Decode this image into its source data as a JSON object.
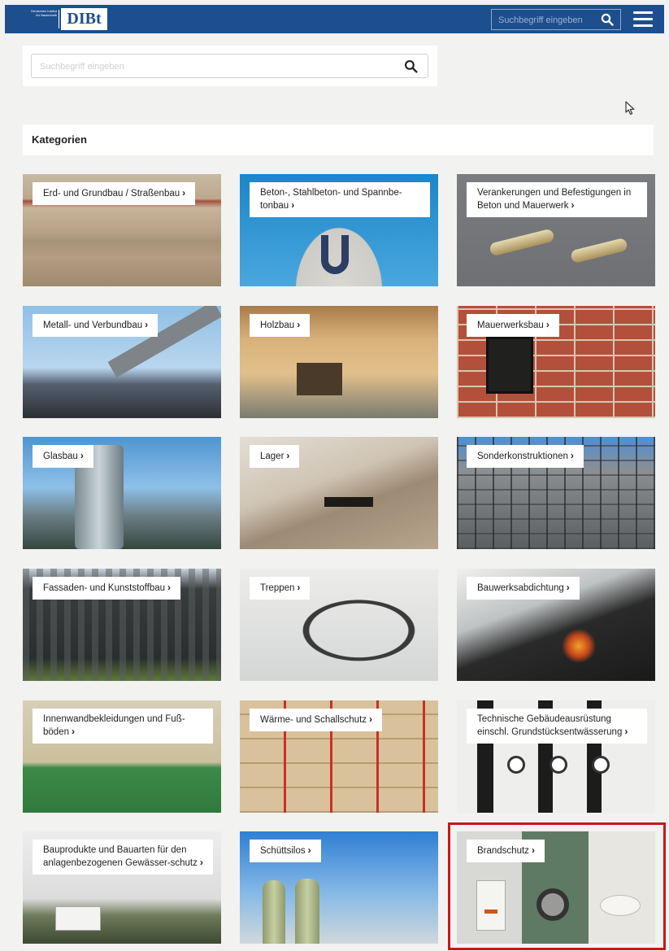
{
  "header": {
    "logo_small": "Deutsches Institut für Bautechnik",
    "logo_main": "DIBt",
    "search_placeholder": "Suchbegriff eingeben",
    "search_icon": "search-icon",
    "menu_icon": "hamburger-menu-icon"
  },
  "search": {
    "placeholder": "Suchbegriff eingeben",
    "icon": "search-icon"
  },
  "section_title": "Kategorien",
  "chevron": "›",
  "tiles": [
    {
      "label": "Erd- und Grundbau / Straßenbau",
      "image": "building-site-photo"
    },
    {
      "label": "Beton-, Stahlbeton- und Spannbe-tonbau",
      "image": "concrete-tower-photo"
    },
    {
      "label": "Verankerungen und Befestigungen in Beton und Mauerwerk",
      "image": "anchor-bolts-photo"
    },
    {
      "label": "Metall- und Verbundbau",
      "image": "steel-structure-photo"
    },
    {
      "label": "Holzbau",
      "image": "timber-house-photo"
    },
    {
      "label": "Mauerwerksbau",
      "image": "brick-wall-lamp-photo"
    },
    {
      "label": "Glasbau",
      "image": "glass-tower-photo"
    },
    {
      "label": "Lager",
      "image": "bridge-bearing-photo"
    },
    {
      "label": "Sonderkonstruktionen",
      "image": "scaffolding-building-photo"
    },
    {
      "label": "Fassaden- und Kunststoffbau",
      "image": "dark-facade-photo"
    },
    {
      "label": "Treppen",
      "image": "spiral-staircase-photo"
    },
    {
      "label": "Bauwerksabdichtung",
      "image": "roof-torch-photo"
    },
    {
      "label": "Innenwandbekleidungen und Fuß-böden",
      "image": "sports-hall-photo"
    },
    {
      "label": "Wärme- und Schallschutz",
      "image": "insulation-facade-photo"
    },
    {
      "label": "Technische Gebäudeausrüstung einschl. Grundstücksentwässerung",
      "image": "pipes-gauges-photo"
    },
    {
      "label": "Bauprodukte und Bauarten für den anlagenbezogenen Gewässer-schutz",
      "image": "industrial-plant-photo"
    },
    {
      "label": "Schüttsilos",
      "image": "silos-photo"
    },
    {
      "label": "Brandschutz",
      "image": "fire-protection-devices-photo"
    }
  ],
  "colors": {
    "header_blue": "#1d4f8f",
    "highlight_red": "#c8161b",
    "page_bg": "#f2f2f0"
  }
}
